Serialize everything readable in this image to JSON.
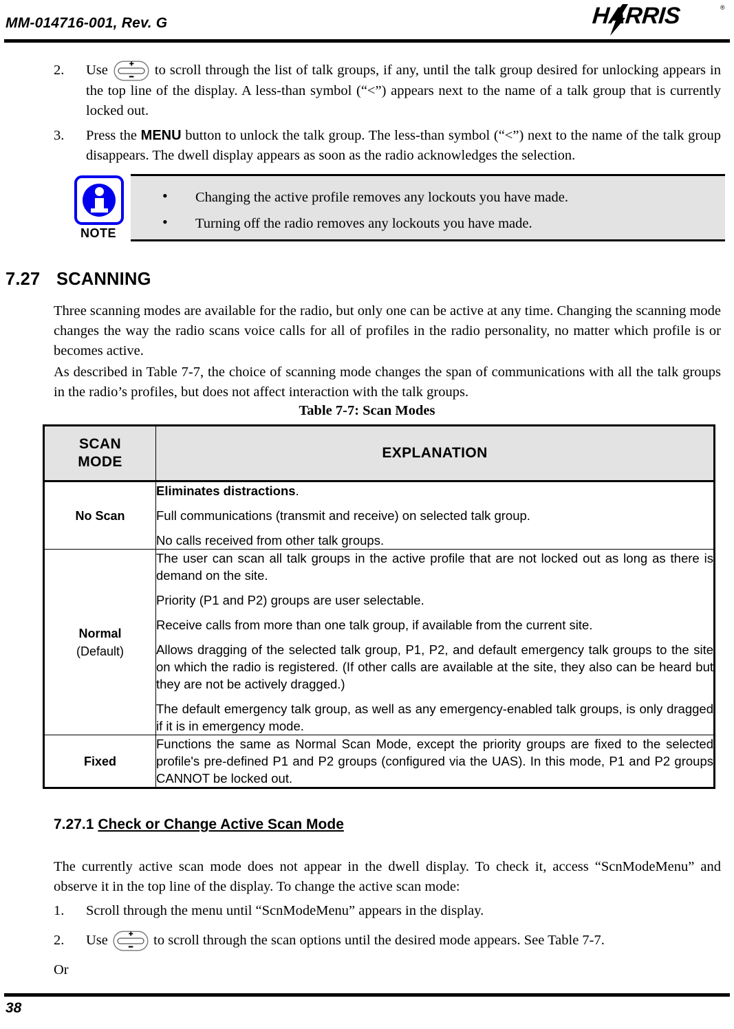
{
  "header": {
    "doc_id": "MM-014716-001, Rev. G",
    "logo_text": "HARRIS",
    "logo_registered": "®"
  },
  "steps_top": [
    {
      "number": "2.",
      "text_before_icon": "Use ",
      "icon": "rocker-switch-icon",
      "text_after_icon": " to scroll through the list of talk groups, if any, until the talk group desired for unlocking appears in the top line of the display. A less-than symbol (“<”) appears next to the name of a talk group that is currently locked out."
    },
    {
      "number": "3.",
      "text_part1": "Press the ",
      "emphasis": "MENU",
      "text_part2": " button to unlock the talk group. The less-than symbol (“<”) next to the name of the talk group disappears. The dwell display appears as soon as the radio acknowledges the selection."
    }
  ],
  "note": {
    "label": "NOTE",
    "icon": "info-icon",
    "bullets": [
      "Changing the active profile removes any lockouts you have made.",
      "Turning off the radio removes any lockouts you have made."
    ]
  },
  "section": {
    "number": "7.27",
    "title": "SCANNING",
    "paragraphs": [
      "Three scanning modes are available for the radio, but only one can be active at any time. Changing the scanning mode changes the way the radio scans voice calls for all of profiles in the radio personality, no matter which profile is or becomes active.",
      "As described in Table 7-7, the choice of scanning mode changes the span of communications with all the talk groups in the radio’s profiles, but does not affect interaction with the talk groups."
    ]
  },
  "table": {
    "caption": "Table 7-7: Scan Modes",
    "headers": [
      "SCAN MODE",
      "EXPLANATION"
    ],
    "header_line1": "SCAN",
    "header_line2": "MODE",
    "rows": [
      {
        "mode": "No Scan",
        "mode_sub": "",
        "paragraphs": [
          {
            "bold_prefix": "Eliminates distractions",
            "rest": "."
          },
          {
            "bold_prefix": "",
            "rest": "Full communications (transmit and receive) on selected talk group."
          },
          {
            "bold_prefix": "",
            "rest": "No calls received from other talk groups."
          }
        ]
      },
      {
        "mode": "Normal",
        "mode_sub": "(Default)",
        "paragraphs": [
          {
            "bold_prefix": "",
            "rest": "The user can scan all talk groups in the active profile that are not locked out as long as there is demand on the site."
          },
          {
            "bold_prefix": "",
            "rest": "Priority (P1 and P2) groups are user selectable."
          },
          {
            "bold_prefix": "",
            "rest": "Receive calls from more than one talk group, if available from the current site."
          },
          {
            "bold_prefix": "",
            "rest": "Allows dragging of the selected talk group, P1, P2, and default emergency talk groups to the site on which the radio is registered. (If other calls are available at the site, they also can be heard but they are not be actively dragged.)"
          },
          {
            "bold_prefix": "",
            "rest": "The default emergency talk group, as well as any emergency-enabled talk groups, is only dragged if it is in emergency mode."
          }
        ]
      },
      {
        "mode": "Fixed",
        "mode_sub": "",
        "paragraphs": [
          {
            "bold_prefix": "",
            "rest": "Functions the same as Normal Scan Mode, except the priority groups are fixed to the selected profile's pre-defined P1 and P2 groups (configured via the UAS). In this mode, P1 and P2 groups CANNOT be locked out."
          }
        ]
      }
    ]
  },
  "subsection": {
    "number": "7.27.1",
    "title": "Check or Change Active Scan Mode",
    "intro": "The currently active scan mode does not appear in the dwell display. To check it, access “ScnModeMenu” and observe it in the top line of the display. To change the active scan mode:",
    "steps": [
      {
        "number": "1.",
        "text": "Scroll through the menu until “ScnModeMenu” appears in the display."
      },
      {
        "number": "2.",
        "text_before_icon": "Use ",
        "icon": "rocker-switch-icon",
        "text_after_icon": " to scroll through the scan options until the desired mode appears. See Table 7-7."
      }
    ],
    "or_text": "Or"
  },
  "footer": {
    "page_number": "38"
  },
  "icons": {
    "rocker_plus": "+",
    "rocker_minus": "-"
  },
  "colors": {
    "note_blue": "#0000EE",
    "table_header_bg": "#E3E3E3",
    "note_bg": "#E3E3E3"
  }
}
